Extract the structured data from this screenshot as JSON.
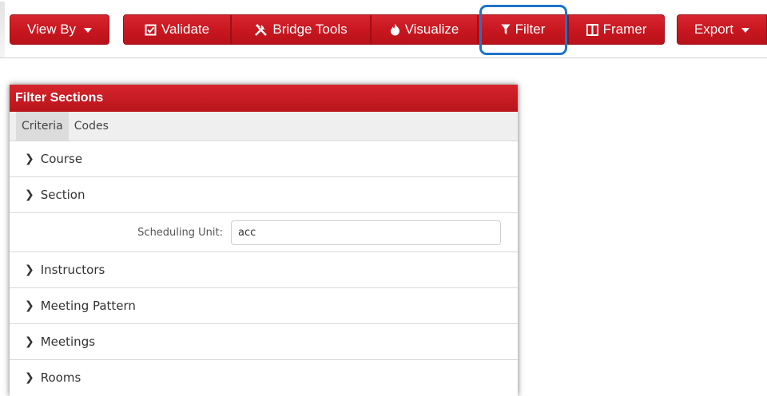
{
  "toolbar": {
    "view_by": {
      "label": "View By",
      "icon": "caret-down-icon"
    },
    "validate": {
      "label": "Validate",
      "icon": "check-square-icon"
    },
    "bridge_tools": {
      "label": "Bridge Tools",
      "icon": "tools-icon"
    },
    "visualize": {
      "label": "Visualize",
      "icon": "fire-icon"
    },
    "filter": {
      "label": "Filter",
      "icon": "funnel-icon",
      "highlighted": true
    },
    "framer": {
      "label": "Framer",
      "icon": "columns-icon"
    },
    "export": {
      "label": "Export",
      "icon": "caret-down-icon"
    }
  },
  "colors": {
    "button_red": "#c8161f",
    "highlight_blue": "#1f73c8",
    "header_red": "#c91c24"
  },
  "panel": {
    "title": "Filter Sections",
    "tabs": [
      {
        "label": "Criteria",
        "active": true
      },
      {
        "label": "Codes",
        "active": false
      }
    ],
    "sections": [
      {
        "label": "Course"
      },
      {
        "label": "Section"
      },
      {
        "label": "Instructors"
      },
      {
        "label": "Meeting Pattern"
      },
      {
        "label": "Meetings"
      },
      {
        "label": "Rooms"
      }
    ],
    "scheduling_unit": {
      "label": "Scheduling Unit:",
      "value": "acc"
    }
  }
}
